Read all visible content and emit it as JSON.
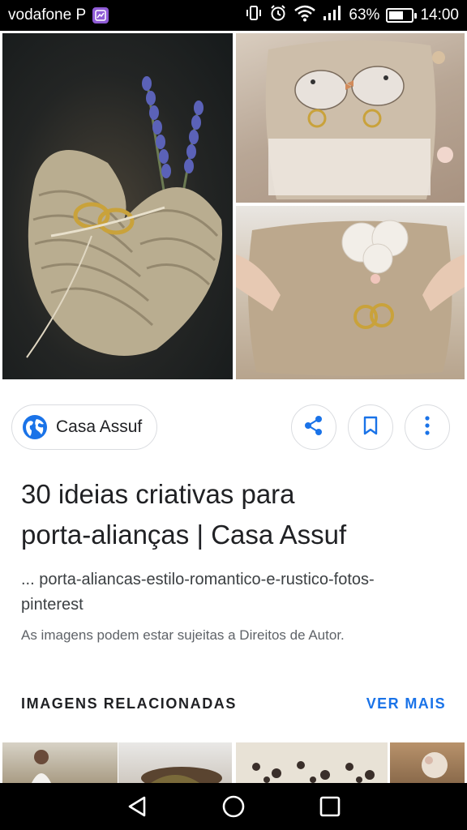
{
  "status_bar": {
    "carrier": "vodafone P",
    "battery": "63%",
    "battery_level": 0.63,
    "time": "14:00",
    "icons": [
      "gallery-notification-icon",
      "vibrate-icon",
      "alarm-icon",
      "wifi-icon",
      "signal-icon",
      "battery-icon"
    ]
  },
  "source": {
    "name": "Casa Assuf",
    "icon": "globe-icon"
  },
  "actions": {
    "share_icon": "share-icon",
    "save_icon": "bookmark-icon",
    "more_icon": "more-vert-icon"
  },
  "result": {
    "title_line1": "30 ideias criativas para",
    "title_line2": "porta-alianças | Casa Assuf",
    "url_line1": "... porta-aliancas-estilo-romantico-e-rustico-fotos-",
    "url_line2": "pinterest",
    "rights_notice": "As imagens podem estar sujeitas a Direitos de Autor."
  },
  "related": {
    "label": "IMAGENS RELACIONADAS",
    "see_more": "VER MAIS"
  },
  "colors": {
    "accent": "#1a73e8",
    "text": "#202124",
    "muted": "#5f6368"
  },
  "nav": [
    "back-icon",
    "home-icon",
    "recents-icon"
  ]
}
